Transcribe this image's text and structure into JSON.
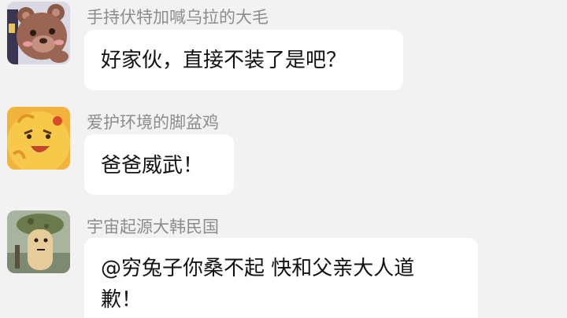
{
  "messages": [
    {
      "sender": "手持伏特加喊乌拉的大毛",
      "text": "好家伙，直接不装了是吧？",
      "avatar_icon": "brown-bear-avatar"
    },
    {
      "sender": "爱护环境的脚盆鸡",
      "text": "爸爸威武！",
      "avatar_icon": "yellow-chick-avatar"
    },
    {
      "sender": "宇宙起源大韩民国",
      "text_line1": "@穷兔子你桑不起 快和父亲大人道",
      "text_line2": "歉！",
      "avatar_icon": "soldier-helmet-avatar"
    }
  ],
  "colors": {
    "background": "#f2f2f2",
    "bubble": "#ffffff",
    "sender_name": "#8c8c8c",
    "message_text": "#111111"
  }
}
